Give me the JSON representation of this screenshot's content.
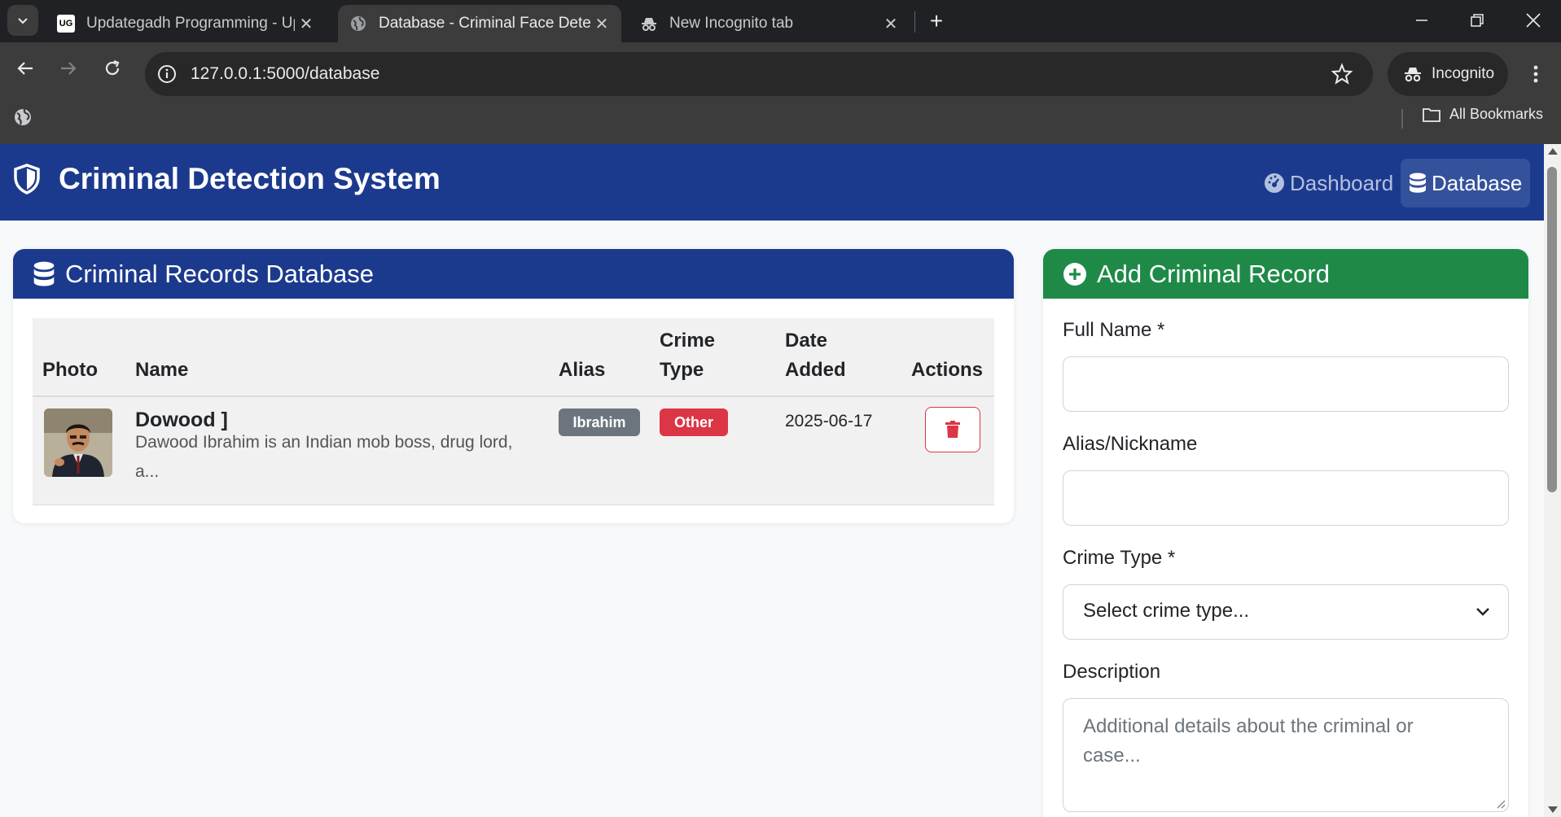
{
  "browser": {
    "tabs": [
      {
        "title": "Updategadh Programming - Up",
        "favicon": "updategadh-logo-icon",
        "favicon_text": "UG"
      },
      {
        "title": "Database - Criminal Face Detect",
        "favicon": "globe-icon"
      },
      {
        "title": "New Incognito tab",
        "favicon": "incognito-icon"
      }
    ],
    "url": "127.0.0.1:5000/database",
    "profile_label": "Incognito",
    "all_bookmarks": "All Bookmarks"
  },
  "navbar": {
    "brand": "Criminal Detection System",
    "links": [
      {
        "label": "Dashboard",
        "icon": "gauge-icon",
        "active": false
      },
      {
        "label": "Database",
        "icon": "database-icon",
        "active": true
      }
    ]
  },
  "records": {
    "title": "Criminal Records Database",
    "columns": {
      "photo": "Photo",
      "name": "Name",
      "alias": "Alias",
      "crime_type_1": "Crime",
      "crime_type_2": "Type",
      "date_added_1": "Date",
      "date_added_2": "Added",
      "actions": "Actions"
    },
    "rows": [
      {
        "name": "Dowood ]",
        "description_line1": "Dawood Ibrahim is an Indian mob boss, drug lord,",
        "description_line2": "a...",
        "alias": "Ibrahim",
        "crime_type": "Other",
        "date_added": "2025-06-17"
      }
    ]
  },
  "add_form": {
    "title": "Add Criminal Record",
    "full_name_label": "Full Name *",
    "full_name_value": "",
    "alias_label": "Alias/Nickname",
    "alias_value": "",
    "crime_type_label": "Crime Type *",
    "crime_type_selected": "Select crime type...",
    "description_label": "Description",
    "description_placeholder_line1": "Additional details about the criminal or",
    "description_placeholder_line2": "case..."
  },
  "colors": {
    "navbar": "#1c3a8d",
    "records_header": "#1c3a8d",
    "add_header": "#1f8a48",
    "danger": "#dc3545",
    "secondary": "#6c757d"
  }
}
